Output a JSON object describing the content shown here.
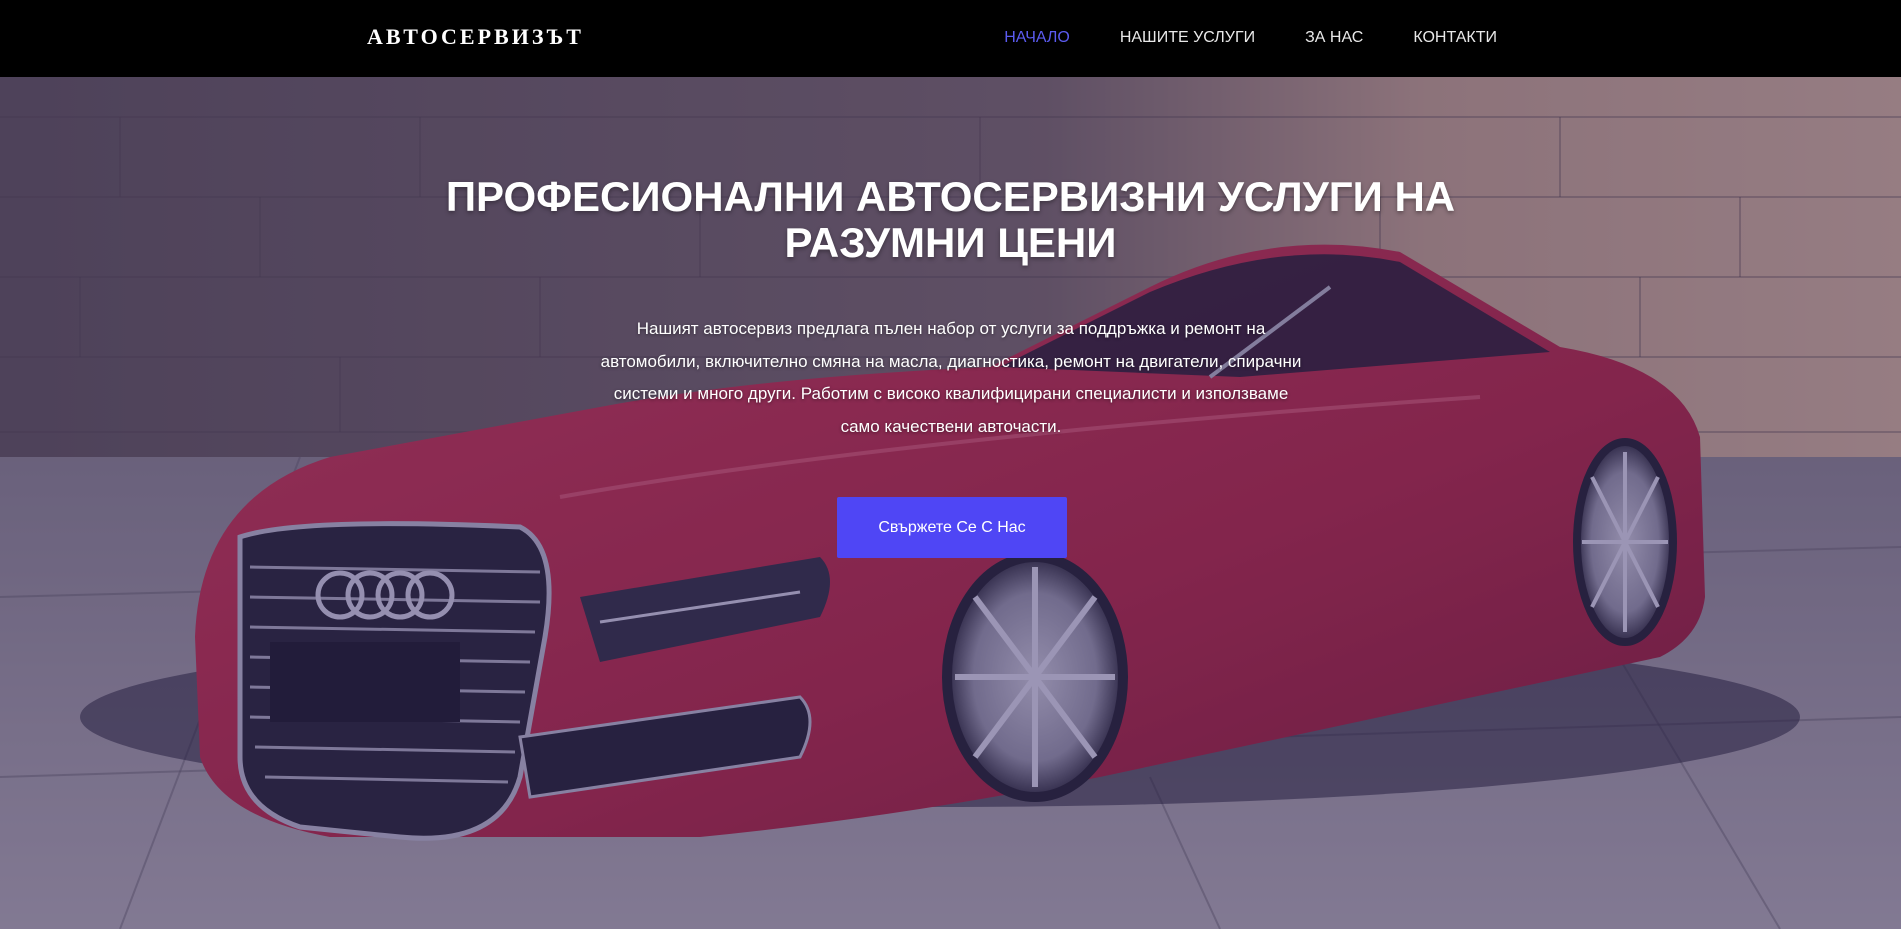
{
  "nav": {
    "brand": "АВТОСЕРВИЗЪТ",
    "items": [
      {
        "label": "НАЧАЛО",
        "active": true
      },
      {
        "label": "НАШИТЕ УСЛУГИ",
        "active": false
      },
      {
        "label": "ЗА НАС",
        "active": false
      },
      {
        "label": "КОНТАКТИ",
        "active": false
      }
    ]
  },
  "hero": {
    "title": "ПРОФЕСИОНАЛНИ АВТОСЕРВИЗНИ УСЛУГИ НА РАЗУМНИ ЦЕНИ",
    "description": "Нашият автосервиз предлага пълен набор от услуги за поддръжка и ремонт на автомобили, включително смяна на масла, диагностика, ремонт на двигатели, спирачни системи и много други. Работим с високо квалифицирани специалисти и използваме само качествени авточасти.",
    "cta_label": "Свържете Се С Нас"
  },
  "colors": {
    "navbar_bg": "#000000",
    "nav_active": "#5b5bf0",
    "cta_bg": "#4f46f5",
    "overlay": "#3a2c6e",
    "car_body": "#c8283c"
  }
}
